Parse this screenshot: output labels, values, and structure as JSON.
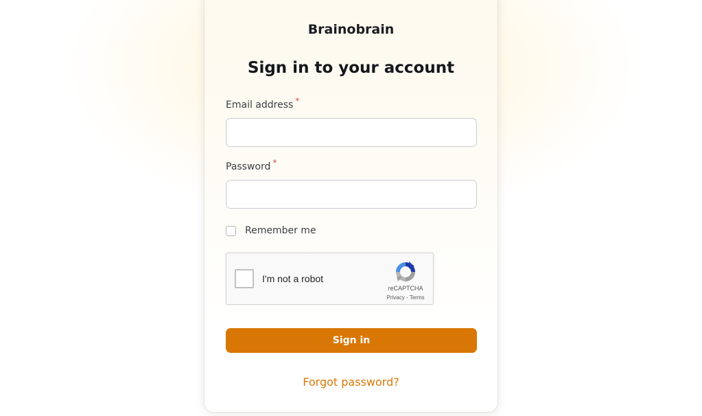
{
  "brand": {
    "name": "Brainobrain"
  },
  "form": {
    "heading": "Sign in to your account",
    "email": {
      "label": "Email address",
      "required_marker": "*",
      "value": "",
      "placeholder": ""
    },
    "password": {
      "label": "Password",
      "required_marker": "*",
      "value": "",
      "placeholder": ""
    },
    "remember": {
      "label": "Remember me",
      "checked": false
    },
    "recaptcha": {
      "label": "I'm not a robot",
      "brand": "reCAPTCHA",
      "privacy": "Privacy",
      "separator": "-",
      "terms": "Terms",
      "checked": false,
      "icon": "recaptcha-logo-icon"
    },
    "submit_label": "Sign in",
    "forgot_label": "Forgot password?"
  },
  "colors": {
    "accent": "#d97706",
    "required": "#e0454d",
    "background_glow": "#feefc4"
  }
}
